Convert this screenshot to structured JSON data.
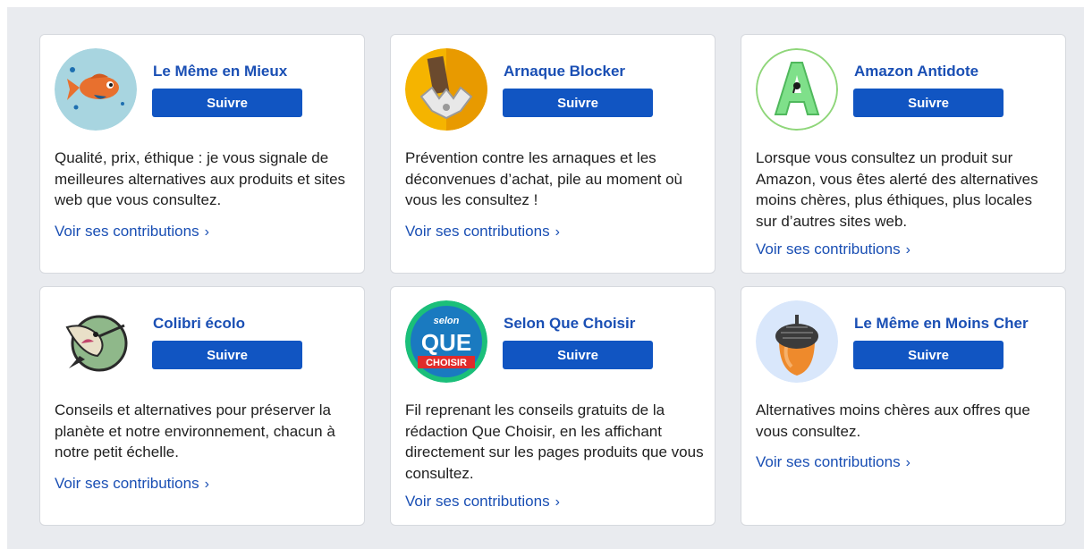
{
  "follow_label": "Suivre",
  "contributions_label": "Voir ses contributions",
  "chevron": "›",
  "cards": [
    {
      "name": "Le Même en Mieux",
      "icon": "fish-icon",
      "description": "Qualité, prix, éthique : je vous signale de meilleures alternatives aux produits et sites web que vous consultez."
    },
    {
      "name": "Arnaque Blocker",
      "icon": "trap-icon",
      "description": "Prévention contre les arnaques et les déconvenues d’achat, pile au moment où vous les consultez !"
    },
    {
      "name": "Amazon Antidote",
      "icon": "letter-a-icon",
      "description": "Lorsque vous consultez un produit sur Amazon, vous êtes alerté des alternatives moins chères, plus éthiques, plus locales sur d’autres sites web."
    },
    {
      "name": "Colibri écolo",
      "icon": "hummingbird-icon",
      "description": "Conseils et alternatives pour préserver la planète et notre environnement, chacun à notre petit échelle."
    },
    {
      "name": "Selon Que Choisir",
      "icon": "que-choisir-logo",
      "logo_text": [
        "selon",
        "QUE",
        "CHOISIR"
      ],
      "description": "Fil reprenant les conseils gratuits de la rédaction Que Choisir, en les affichant directement sur les pages produits que vous consultez."
    },
    {
      "name": "Le Même en Moins Cher",
      "icon": "acorn-icon",
      "description": "Alternatives moins chères aux offres que vous consultez."
    }
  ]
}
